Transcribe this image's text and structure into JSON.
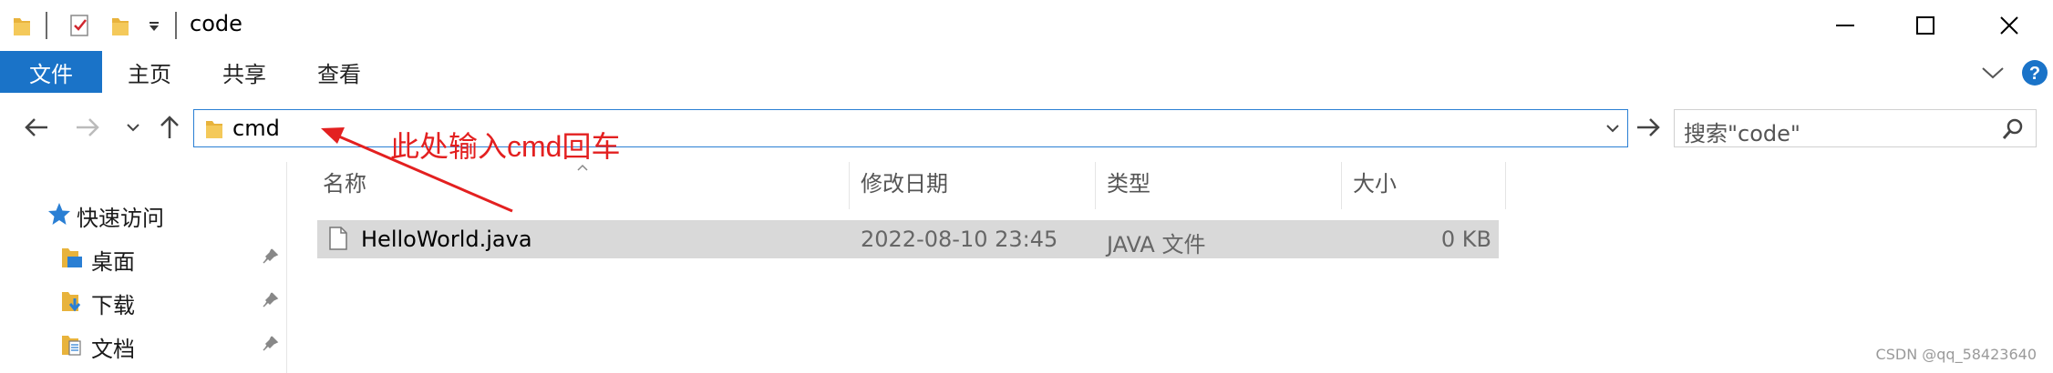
{
  "window": {
    "title": "code",
    "minimize_glyph": "—",
    "close_glyph": "✕"
  },
  "ribbon": {
    "tabs": [
      "文件",
      "主页",
      "共享",
      "查看"
    ]
  },
  "address_bar": {
    "value": "cmd"
  },
  "search": {
    "placeholder": "搜索\"code\""
  },
  "annotation": {
    "text": "此处输入cmd回车",
    "color": "#e32020"
  },
  "sidebar": {
    "quick_access": "快速访问",
    "items": [
      {
        "label": "桌面",
        "icon": "desktop-folder-icon"
      },
      {
        "label": "下载",
        "icon": "downloads-folder-icon"
      },
      {
        "label": "文档",
        "icon": "documents-folder-icon"
      }
    ]
  },
  "file_list": {
    "columns": [
      "名称",
      "修改日期",
      "类型",
      "大小"
    ],
    "rows": [
      {
        "name": "HelloWorld.java",
        "modified": "2022-08-10 23:45",
        "type": "JAVA 文件",
        "size": "0 KB"
      }
    ]
  },
  "watermark": "CSDN @qq_58423640",
  "colors": {
    "accent": "#1a73c8",
    "selected_row": "#d9d9d9",
    "folder": "#e8b33c"
  }
}
